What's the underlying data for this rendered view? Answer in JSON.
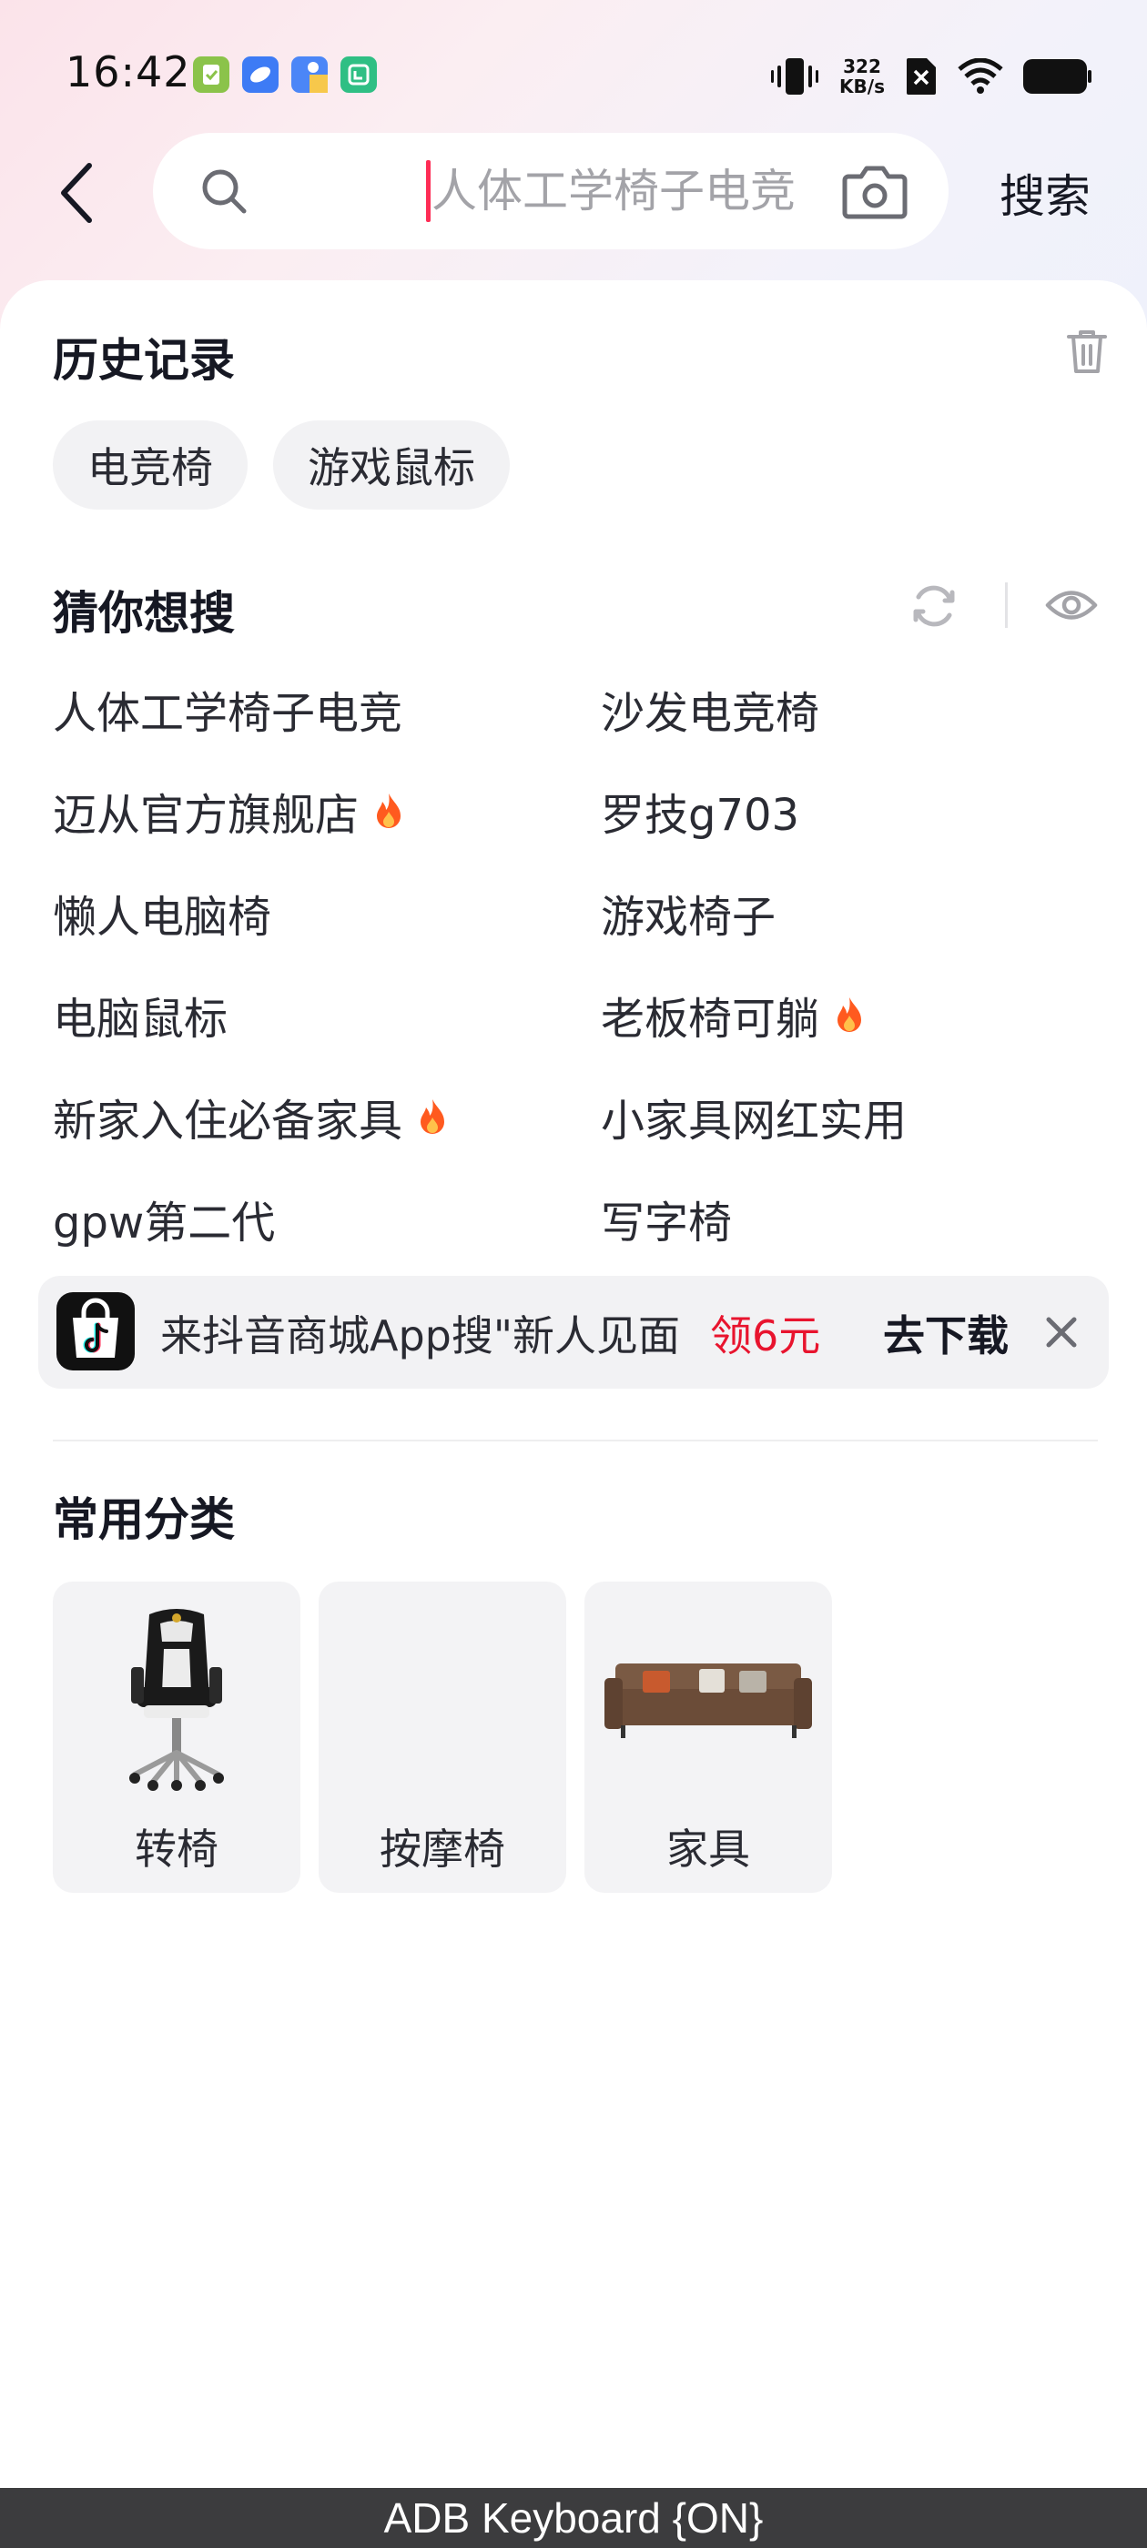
{
  "status_bar": {
    "time": "16:42",
    "net_speed_value": "322",
    "net_speed_unit": "KB/s",
    "battery_color": "#111111"
  },
  "search": {
    "placeholder": "人体工学椅子电竞",
    "value": "",
    "submit_label": "搜索"
  },
  "history": {
    "title": "历史记录",
    "items": [
      "电竞椅",
      "游戏鼠标"
    ]
  },
  "suggestions": {
    "title": "猜你想搜",
    "left": [
      {
        "text": "人体工学椅子电竞",
        "hot": false
      },
      {
        "text": "迈从官方旗舰店",
        "hot": true
      },
      {
        "text": "懒人电脑椅",
        "hot": false
      },
      {
        "text": "电脑鼠标",
        "hot": false
      },
      {
        "text": "新家入住必备家具",
        "hot": true
      },
      {
        "text": "gpw第二代",
        "hot": false
      }
    ],
    "right": [
      {
        "text": "沙发电竞椅",
        "hot": false
      },
      {
        "text": "罗技g703",
        "hot": false
      },
      {
        "text": "游戏椅子",
        "hot": false
      },
      {
        "text": "老板椅可躺",
        "hot": true
      },
      {
        "text": "小家具网红实用",
        "hot": false
      },
      {
        "text": "写字椅",
        "hot": false
      }
    ]
  },
  "banner": {
    "text": "来抖音商城App搜\"新人见面",
    "reward": "领6元",
    "download_label": "去下载"
  },
  "categories": {
    "title": "常用分类",
    "items": [
      "转椅",
      "按摩椅",
      "家具"
    ]
  },
  "keyboard_bar": {
    "label": "ADB Keyboard {ON}"
  },
  "colors": {
    "accent": "#fe2c55",
    "reward_red": "#e8142e",
    "chip_bg": "#f2f2f4",
    "hot_icon": "#ff5a1f"
  }
}
